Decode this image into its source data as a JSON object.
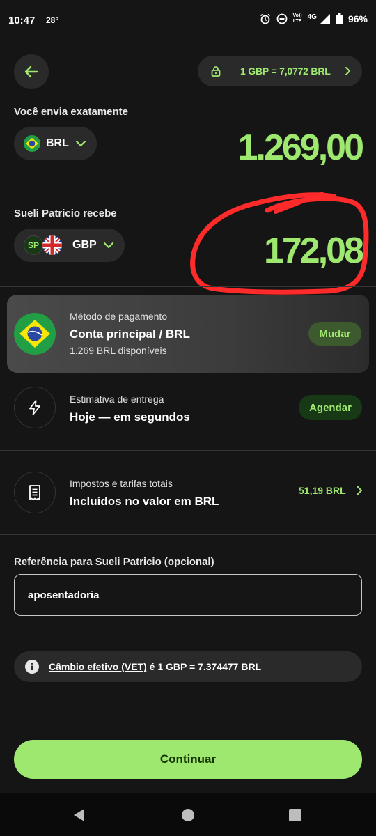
{
  "status_bar": {
    "time": "10:47",
    "temperature": "28°",
    "volte_top": "Vo))",
    "volte_bottom": "LTE",
    "network": "4G",
    "battery": "96%"
  },
  "header": {
    "rate_text": "1 GBP = 7,0772 BRL"
  },
  "send": {
    "label": "Você envia exatamente",
    "currency": "BRL",
    "amount": "1.269,00"
  },
  "receive": {
    "label": "Sueli Patricio recebe",
    "initials": "SP",
    "currency": "GBP",
    "amount": "172,08"
  },
  "payment_method": {
    "title": "Método de pagamento",
    "main": "Conta principal / BRL",
    "sub": "1.269 BRL disponíveis",
    "change_label": "Mudar"
  },
  "delivery": {
    "title": "Estimativa de entrega",
    "main": "Hoje — em segundos",
    "schedule_label": "Agendar"
  },
  "fees": {
    "title": "Impostos e tarifas totais",
    "main": "Incluídos no valor em BRL",
    "amount": "51,19 BRL"
  },
  "reference": {
    "label": "Referência para Sueli Patricio (opcional)",
    "value": "aposentadoria"
  },
  "vet_info": {
    "link": "Câmbio efetivo (VET)",
    "text": " é 1 GBP = 7.374477 BRL"
  },
  "continue_label": "Continuar",
  "colors": {
    "accent": "#9fe870",
    "background": "#151515",
    "chip_bg": "#183915",
    "annotation": "#ff2a2a"
  }
}
